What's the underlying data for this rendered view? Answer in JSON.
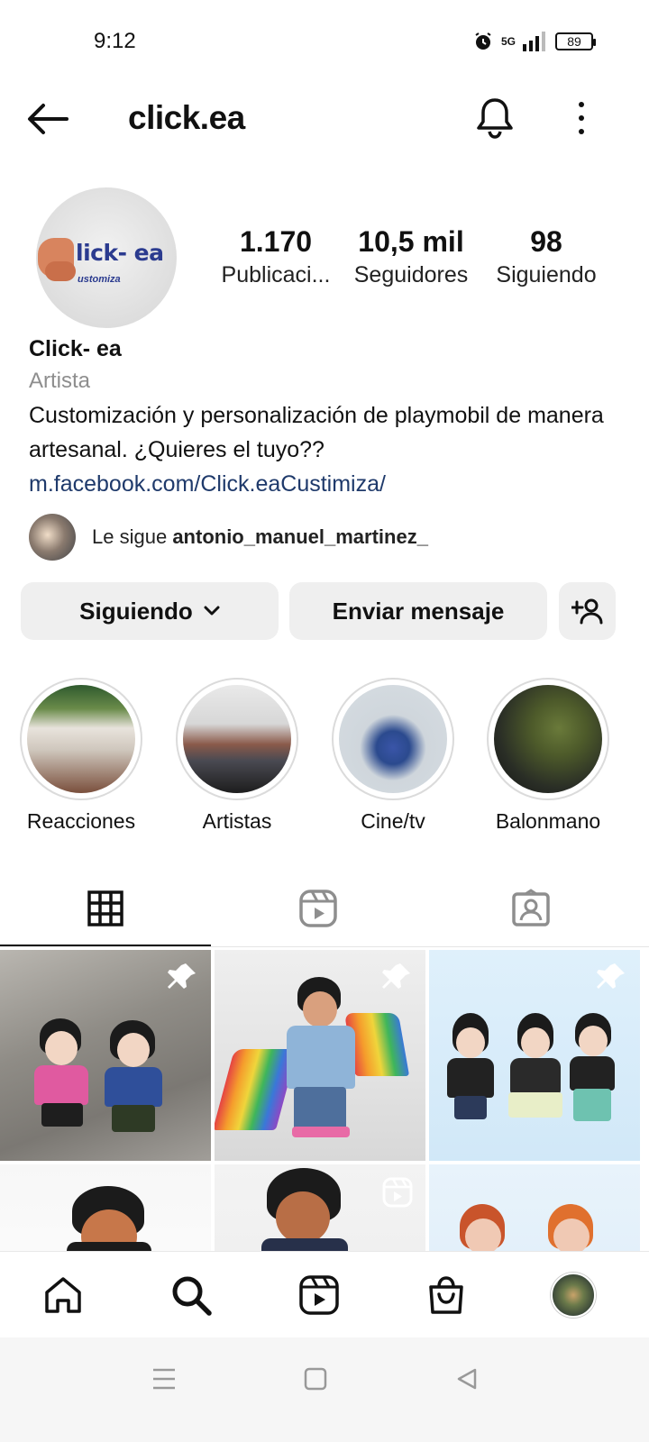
{
  "status_bar": {
    "time": "9:12",
    "network": "5G",
    "battery": "89"
  },
  "header": {
    "username": "click.ea"
  },
  "profile": {
    "avatar_logo_main": "lick- ea",
    "avatar_logo_sub": "ustomiza",
    "stats": {
      "posts_value": "1.170",
      "posts_label": "Publicaci...",
      "followers_value": "10,5 mil",
      "followers_label": "Seguidores",
      "following_value": "98",
      "following_label": "Siguiendo"
    },
    "display_name": "Click- ea",
    "category": "Artista",
    "bio": "Customización y personalización de playmobil de manera artesanal. ¿Quieres el tuyo??",
    "link": "m.facebook.com/Click.eaCustimiza/",
    "followed_by_prefix": "Le sigue",
    "followed_by_user": "antonio_manuel_martinez_"
  },
  "actions": {
    "following_label": "Siguiendo",
    "message_label": "Enviar mensaje",
    "add_user_icon": "add-user-icon"
  },
  "highlights": [
    {
      "label": "Reacciones"
    },
    {
      "label": "Artistas"
    },
    {
      "label": "Cine/tv"
    },
    {
      "label": "Balonmano"
    }
  ],
  "tabs": [
    {
      "name": "grid-icon",
      "active": true
    },
    {
      "name": "reels-icon",
      "active": false
    },
    {
      "name": "tagged-icon",
      "active": false
    }
  ],
  "grid": [
    {
      "pinned": true,
      "type": "photo"
    },
    {
      "pinned": true,
      "type": "photo"
    },
    {
      "pinned": true,
      "type": "photo"
    },
    {
      "pinned": false,
      "type": "photo"
    },
    {
      "pinned": false,
      "type": "reel"
    },
    {
      "pinned": false,
      "type": "photo"
    }
  ],
  "bottom_nav": [
    "home-icon",
    "search-icon",
    "reels-icon",
    "shop-icon",
    "profile-avatar"
  ],
  "system_nav": [
    "menu-icon",
    "home-square-icon",
    "back-triangle-icon"
  ]
}
